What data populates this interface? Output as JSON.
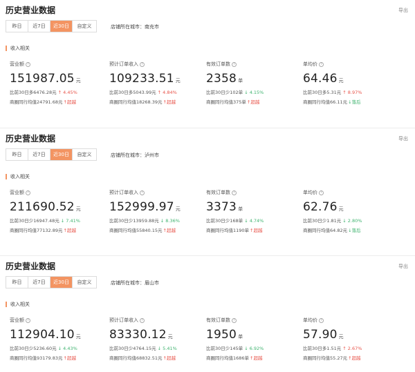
{
  "title": "历史营业数据",
  "export_label": "导出",
  "tabs": [
    "昨日",
    "近7日",
    "近30日",
    "自定义"
  ],
  "active_tab_index": 2,
  "accent_color": "#f39462",
  "up_color": "#e8544a",
  "down_color": "#3fb36f",
  "section_label": "收入相关",
  "icons": {
    "help": "question-circle-icon"
  },
  "panels": [
    {
      "city": "店铺所在城市：南充市",
      "metrics": [
        {
          "label": "营业额",
          "value": "151987.05",
          "unit": "元",
          "compare": "比前30日多6476.28元",
          "compare_pct": "↑ 4.45%",
          "compare_dir": "up",
          "avg": "商圈同行均值24791.68元",
          "avg_badge": "↑超越",
          "avg_dir": "up"
        },
        {
          "label": "预计订单收入",
          "value": "109233.51",
          "unit": "元",
          "compare": "比前30日多5043.99元",
          "compare_pct": "↑ 4.84%",
          "compare_dir": "up",
          "avg": "商圈同行均值18268.39元",
          "avg_badge": "↑超越",
          "avg_dir": "up"
        },
        {
          "label": "有效订单数",
          "value": "2358",
          "unit": "单",
          "compare": "比前30日少102单",
          "compare_pct": "↓ 4.15%",
          "compare_dir": "down",
          "avg": "商圈同行均值375单",
          "avg_badge": "↑超越",
          "avg_dir": "up"
        },
        {
          "label": "单均价",
          "value": "64.46",
          "unit": "元",
          "compare": "比前30日多5.31元",
          "compare_pct": "↑ 8.97%",
          "compare_dir": "up",
          "avg": "商圈同行均值66.11元",
          "avg_badge": "↓落后",
          "avg_dir": "down"
        }
      ]
    },
    {
      "city": "店铺所在城市：泸州市",
      "metrics": [
        {
          "label": "营业额",
          "value": "211690.52",
          "unit": "元",
          "compare": "比前30日少16947.48元",
          "compare_pct": "↓ 7.41%",
          "compare_dir": "down",
          "avg": "商圈同行均值77132.89元",
          "avg_badge": "↑超越",
          "avg_dir": "up"
        },
        {
          "label": "预计订单收入",
          "value": "152999.97",
          "unit": "元",
          "compare": "比前30日少13959.88元",
          "compare_pct": "↓ 8.36%",
          "compare_dir": "down",
          "avg": "商圈同行均值55840.15元",
          "avg_badge": "↑超越",
          "avg_dir": "up"
        },
        {
          "label": "有效订单数",
          "value": "3373",
          "unit": "单",
          "compare": "比前30日少168单",
          "compare_pct": "↓ 4.74%",
          "compare_dir": "down",
          "avg": "商圈同行均值1190单",
          "avg_badge": "↑超越",
          "avg_dir": "up"
        },
        {
          "label": "单均价",
          "value": "62.76",
          "unit": "元",
          "compare": "比前30日少1.81元",
          "compare_pct": "↓ 2.80%",
          "compare_dir": "down",
          "avg": "商圈同行均值64.82元",
          "avg_badge": "↓落后",
          "avg_dir": "down"
        }
      ]
    },
    {
      "city": "店铺所在城市：眉山市",
      "metrics": [
        {
          "label": "营业额",
          "value": "112904.10",
          "unit": "元",
          "compare": "比前30日少5236.60元",
          "compare_pct": "↓ 4.43%",
          "compare_dir": "down",
          "avg": "商圈同行均值93179.83元",
          "avg_badge": "↑超越",
          "avg_dir": "up"
        },
        {
          "label": "预计订单收入",
          "value": "83330.12",
          "unit": "元",
          "compare": "比前30日少4764.15元",
          "compare_pct": "↓ 5.41%",
          "compare_dir": "down",
          "avg": "商圈同行均值68832.51元",
          "avg_badge": "↑超越",
          "avg_dir": "up"
        },
        {
          "label": "有效订单数",
          "value": "1950",
          "unit": "单",
          "compare": "比前30日少145单",
          "compare_pct": "↓ 6.92%",
          "compare_dir": "down",
          "avg": "商圈同行均值1686单",
          "avg_badge": "↑超越",
          "avg_dir": "up"
        },
        {
          "label": "单均价",
          "value": "57.90",
          "unit": "元",
          "compare": "比前30日多1.51元",
          "compare_pct": "↑ 2.67%",
          "compare_dir": "up",
          "avg": "商圈同行均值55.27元",
          "avg_badge": "↑超越",
          "avg_dir": "up"
        }
      ]
    }
  ]
}
